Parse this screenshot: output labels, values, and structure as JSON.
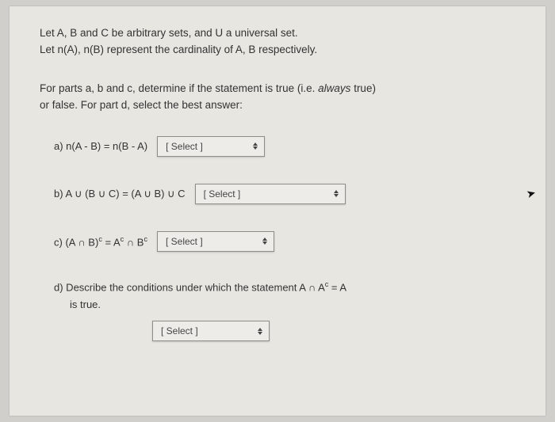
{
  "intro": {
    "line1": "Let A, B and C be arbitrary sets, and U a universal set.",
    "line2": "Let n(A), n(B) represent the cardinality of A, B respectively."
  },
  "instructions": {
    "line1_pre": "For parts a, b and c, determine if the statement is true (i.e. ",
    "line1_italic": "always",
    "line1_post": " true)",
    "line2": "or false.  For part d, select the best answer:"
  },
  "parts": {
    "a": {
      "label": "a)",
      "stmt": " n(A - B) = n(B - A)"
    },
    "b": {
      "label": "b)",
      "stmt": " A ∪ (B ∪ C) = (A ∪ B) ∪ C"
    },
    "c": {
      "label": "c)",
      "stmt_pre": " (A ∩ B)",
      "sup1": "c",
      "stmt_mid": " = A",
      "sup2": "c",
      "stmt_mid2": " ∩ B",
      "sup3": "c"
    },
    "d": {
      "label": "d)",
      "text_pre": " Describe the conditions under which the statement A ∩ A",
      "sup": "c",
      "text_post": " = A",
      "line2": "is true."
    }
  },
  "select_text": "[ Select ]"
}
